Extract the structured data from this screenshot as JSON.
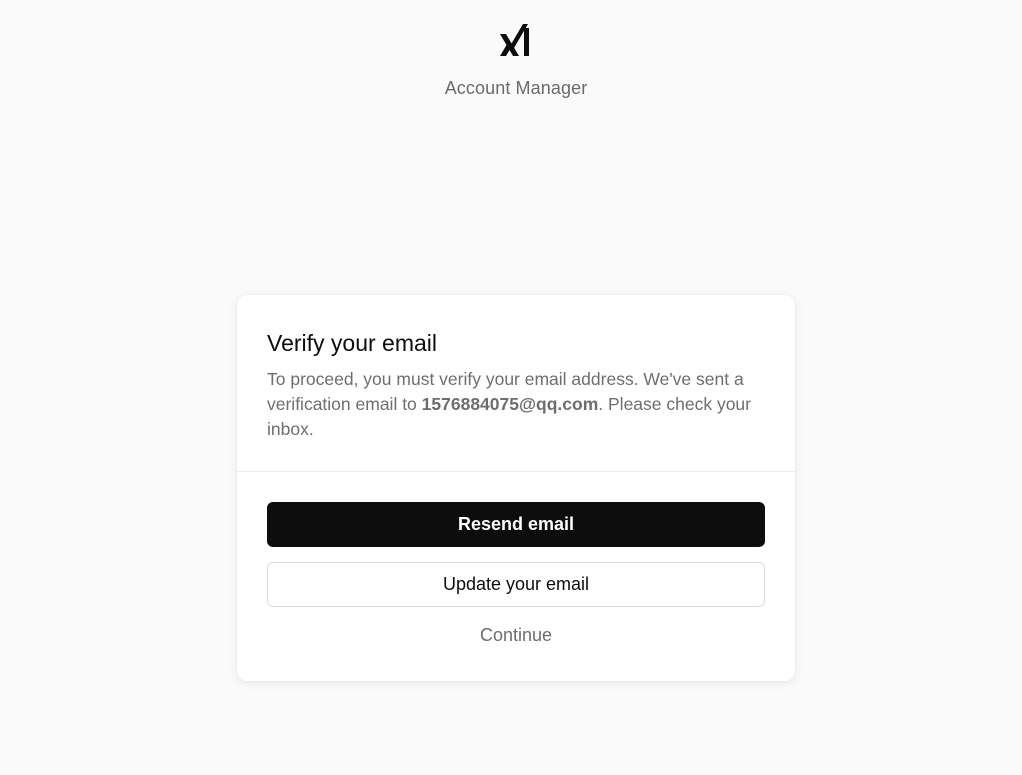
{
  "header": {
    "logo_icon": "xai-logo-icon",
    "app_name": "Account Manager"
  },
  "card": {
    "title": "Verify your email",
    "message_part1": "To proceed, you must verify your email address. We've sent a verification email to ",
    "email": "1576884075@qq.com",
    "message_part2": ". Please check your inbox.",
    "resend_label": "Resend email",
    "update_label": "Update your email",
    "continue_label": "Continue"
  },
  "colors": {
    "background": "#fafafa",
    "primary_button": "#0d0d0d",
    "muted_text": "#6e6e6e"
  }
}
